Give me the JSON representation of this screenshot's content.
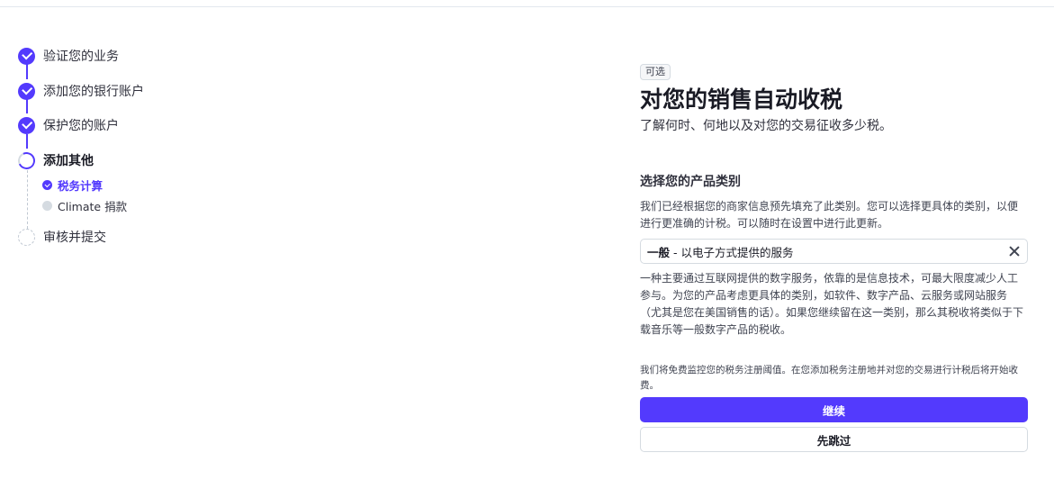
{
  "steps": [
    {
      "label": "验证您的业务",
      "status": "done"
    },
    {
      "label": "添加您的银行账户",
      "status": "done"
    },
    {
      "label": "保护您的账户",
      "status": "done"
    },
    {
      "label": "添加其他",
      "status": "current"
    },
    {
      "label": "审核并提交",
      "status": "pending"
    }
  ],
  "substeps": [
    {
      "label": "税务计算",
      "status": "done"
    },
    {
      "label": "Climate 捐款",
      "status": "pending"
    }
  ],
  "panel": {
    "badge": "可选",
    "title": "对您的销售自动收税",
    "subtitle": "了解何时、何地以及对您的交易征收多少税。",
    "section_title": "选择您的产品类别",
    "section_desc": "我们已经根据您的商家信息预先填充了此类别。您可以选择更具体的类别，以便进行更准确的计税。可以随时在设置中进行此更新。",
    "category_bold": "一般",
    "category_rest": " - 以电子方式提供的服务",
    "category_explain": "一种主要通过互联网提供的数字服务，依靠的是信息技术，可最大限度减少人工参与。为您的产品考虑更具体的类别，如软件、数字产品、云服务或网站服务（尤其是您在美国销售的话）。如果您继续留在这一类别，那么其税收将类似于下载音乐等一般数字产品的税收。",
    "note": "我们将免费监控您的税务注册阈值。在您添加税务注册地并对您的交易进行计税后将开始收费。",
    "continue_label": "继续",
    "skip_label": "先跳过"
  },
  "colors": {
    "accent": "#533afd",
    "border": "#d5dbe1"
  }
}
